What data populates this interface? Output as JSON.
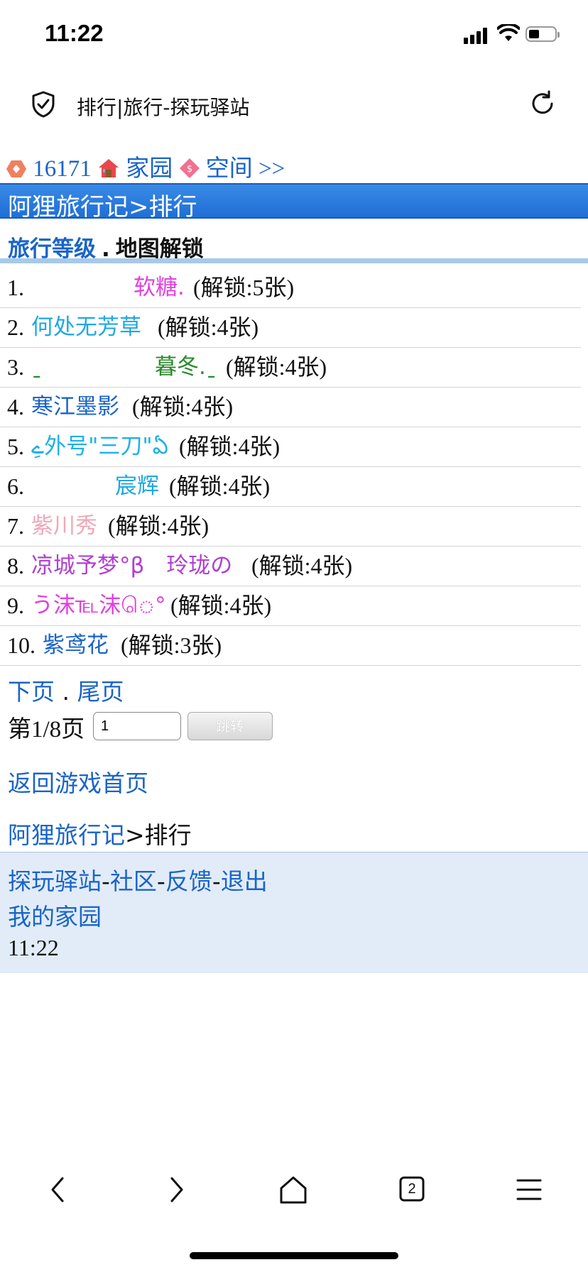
{
  "status_bar": {
    "time": "11:22"
  },
  "browser": {
    "page_title": "排行|旅行-探玩驿站",
    "tab_count": "2"
  },
  "topnav": {
    "coins": "16171",
    "home": "家园",
    "space": "空间 >>"
  },
  "banner": {
    "text": "阿狸旅行记>排行"
  },
  "tabs": {
    "active": "旅行等级",
    "separator": ".",
    "current": "地图解锁"
  },
  "ranking": [
    {
      "num": "1.",
      "name": "软糖.",
      "count": "(解锁:5张)",
      "color": "#e040e0"
    },
    {
      "num": "2.",
      "name": "何处无芳草",
      "count": "(解锁:4张)",
      "color": "#1fa8e0"
    },
    {
      "num": "3.",
      "prefix": "ˍ",
      "name": "暮冬.ˍ",
      "count": "(解锁:4张)",
      "color": "#2a8a2a"
    },
    {
      "num": "4.",
      "name": "寒江墨影",
      "count": "(解锁:4张)",
      "color": "#1a64c8"
    },
    {
      "num": "5.",
      "name": "ےِ外号\"三刀\"ఏ",
      "count": "(解锁:4张)",
      "color": "#1fb0e8"
    },
    {
      "num": "6.",
      "name": "宸辉",
      "count": "(解锁:4张)",
      "color": "#1fa8e0"
    },
    {
      "num": "7.",
      "name": "紫川秀",
      "count": "(解锁:4张)",
      "color": "#f0a8b8"
    },
    {
      "num": "8.",
      "name": "凉城予梦°β　玲珑の",
      "count": "(解锁:4张)",
      "color": "#b040d0"
    },
    {
      "num": "9.",
      "name": "う沫℡沫ெ°",
      "count": "(解锁:4张)",
      "color": "#e040e0"
    },
    {
      "num": "10.",
      "name": "紫鸢花",
      "count": "(解锁:3张)",
      "color": "#1a64c8"
    }
  ],
  "pager": {
    "next": "下页",
    "sep": ".",
    "last": "尾页"
  },
  "jump": {
    "label": "第1/8页",
    "value": "1",
    "button": "跳转"
  },
  "back_home": "返回游戏首页",
  "crumb": {
    "link": "阿狸旅行记",
    "rest": ">排行"
  },
  "footer": {
    "links": [
      "探玩驿站",
      "社区",
      "反馈",
      "退出"
    ],
    "dash": "-",
    "home": "我的家园",
    "time": "11:22"
  }
}
